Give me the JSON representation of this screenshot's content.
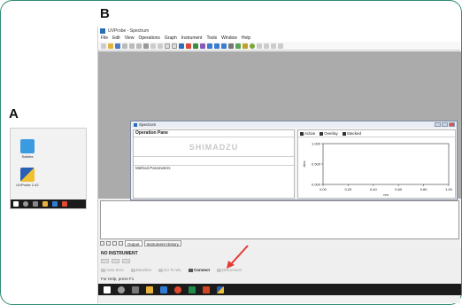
{
  "labels": {
    "a": "A",
    "b": "B"
  },
  "desktop": {
    "icons": [
      {
        "label": "Solidex",
        "color": "#3a9be0"
      },
      {
        "label": "UVProbe 2.42",
        "color": "#2a5fb5"
      }
    ]
  },
  "app": {
    "title": "UVProbe - Spectrum",
    "menus": [
      "File",
      "Edit",
      "View",
      "Operations",
      "Graph",
      "Instrument",
      "Tools",
      "Window",
      "Help"
    ],
    "spectrum_window": {
      "title": "Spectrum",
      "operation_header": "Operation Pane",
      "logo": "SHIMADZU",
      "method_params": "Method Parameters",
      "tabs": [
        "Active",
        "Overlay",
        "Stacked"
      ]
    },
    "output_tabs": [
      "Output",
      "Instrument History"
    ],
    "instrument_status": "NO INSTRUMENT",
    "instrument_buttons": [
      "Auto Zero",
      "Baseline",
      "Go To WL",
      "Connect",
      "Disconnect"
    ],
    "status_bar": "For Help, press F1"
  },
  "colors": {
    "frame": "#2e8b74",
    "arrow": "#e53935"
  },
  "chart_data": {
    "type": "line",
    "title": "",
    "xlabel": "nm",
    "ylabel": "Abs",
    "xticks": [
      "0.00",
      "0.20",
      "0.40",
      "0.60",
      "0.80",
      "1.00"
    ],
    "yticks": [
      "1.000",
      "0.500",
      "0.000"
    ],
    "xlim": [
      0,
      1
    ],
    "ylim": [
      0,
      1
    ],
    "series": []
  }
}
